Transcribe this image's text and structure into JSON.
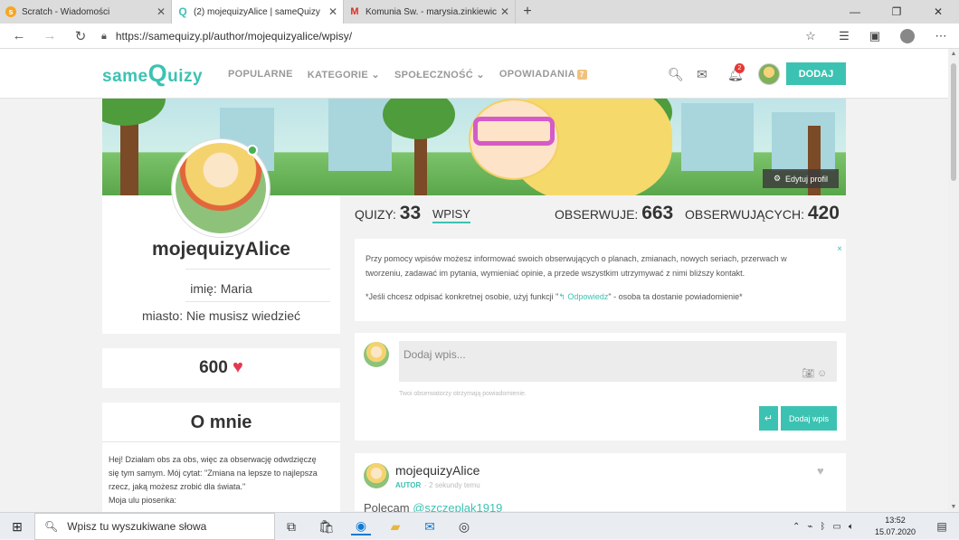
{
  "browser": {
    "tabs": [
      {
        "title": "Scratch - Wiadomości",
        "active": false,
        "icon": "scratch-icon"
      },
      {
        "title": "(2) mojequizyAlice | sameQuizy",
        "active": true,
        "icon": "samequizy-icon"
      },
      {
        "title": "Komunia Św. - marysia.zinkiewicz",
        "active": false,
        "icon": "gmail-icon"
      }
    ],
    "new_tab": "+",
    "url": "https://samequizy.pl/author/mojequizyalice/wpisy/"
  },
  "site": {
    "logo_same": "same",
    "logo_q": "Q",
    "logo_rest": "uizy",
    "menu": [
      {
        "label": "POPULARNE",
        "caret": false
      },
      {
        "label": "KATEGORIE",
        "caret": true
      },
      {
        "label": "SPOŁECZNOŚĆ",
        "caret": true
      },
      {
        "label": "OPOWIADANIA",
        "caret": false,
        "badge": "7"
      }
    ],
    "notif_count": "2",
    "add_button": "DODAJ",
    "accent": "#3cc2b2"
  },
  "profile": {
    "edit_button": "Edytuj profil",
    "username": "mojequizyAlice",
    "name_label": "imię:",
    "name_value": "Maria",
    "city_label": "miasto:",
    "city_value": "Nie musisz wiedzieć",
    "hearts": "600",
    "about_title": "O mnie",
    "about_text": [
      "Hej! Działam obs za obs, więc za obserwację odwdzięczę",
      "się tym samym. Mój cytat: \"Zmiana na lepsze to najlepsza",
      "rzecz, jaką możesz zrobić dla świata.\"",
      "Moja ulu piosenka:"
    ]
  },
  "stats": {
    "quizy_label": "QUIZY:",
    "quizy_value": "33",
    "wpisy_tab": "WPISY",
    "obserwuje_label": "OBSERWUJE:",
    "obserwuje_value": "663",
    "obserwujacych_label": "OBSERWUJĄCYCH:",
    "obserwujacych_value": "420"
  },
  "info_box": {
    "line1": "Przy pomocy wpisów możesz informować swoich obserwujących o planach, zmianach, nowych seriach, przerwach w",
    "line2": "tworzeniu, zadawać im pytania, wymieniać opinie, a przede wszystkim utrzymywać z nimi bliższy kontakt.",
    "line3_pre": "*Jeśli chcesz odpisać konkretnej osobie, użyj funkcji \"",
    "line3_link": "Odpowiedz",
    "line3_post": "\" - osoba ta dostanie powiadomienie*",
    "close": "×"
  },
  "composer": {
    "placeholder": "Dodaj wpis...",
    "hint": "Twoi obserwatorzy otrzymają powiadomienie.",
    "enter_icon": "↵",
    "submit": "Dodaj wpis"
  },
  "post": {
    "author": "mojequizyAlice",
    "author_badge": "AUTOR",
    "time": "· 2 sekundy temu",
    "text_pre": "Polecam ",
    "mention": "@szczeplak1919"
  },
  "taskbar": {
    "search_placeholder": "Wpisz tu wyszukiwane słowa",
    "time": "13:52",
    "date": "15.07.2020"
  }
}
